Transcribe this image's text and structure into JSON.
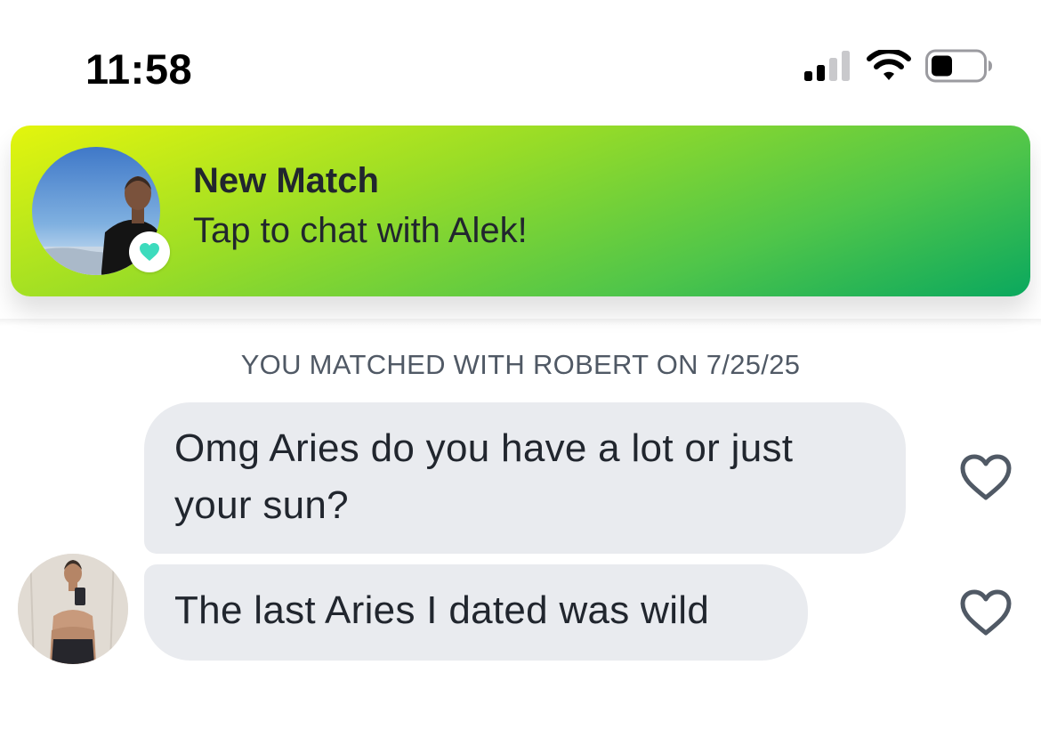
{
  "status_bar": {
    "time": "11:58",
    "icons": [
      "cellular-signal-icon",
      "wifi-icon",
      "battery-icon"
    ]
  },
  "banner": {
    "title": "New Match",
    "subtitle": "Tap to chat with Alek!",
    "badge_icon": "heart-icon",
    "colors": {
      "gradient_start": "#e4f50d",
      "gradient_end": "#0aa85e",
      "heart": "#3ddbbd"
    }
  },
  "chat": {
    "match_info": "YOU MATCHED WITH ROBERT ON 7/25/25",
    "messages": [
      {
        "text": "Omg Aries do you have a lot or just your sun?",
        "like_icon": "heart-outline-icon"
      },
      {
        "text": "The last Aries I dated was wild",
        "like_icon": "heart-outline-icon"
      }
    ],
    "colors": {
      "bubble": "#e9ebef",
      "text": "#21262e",
      "meta_text": "#505965"
    }
  }
}
